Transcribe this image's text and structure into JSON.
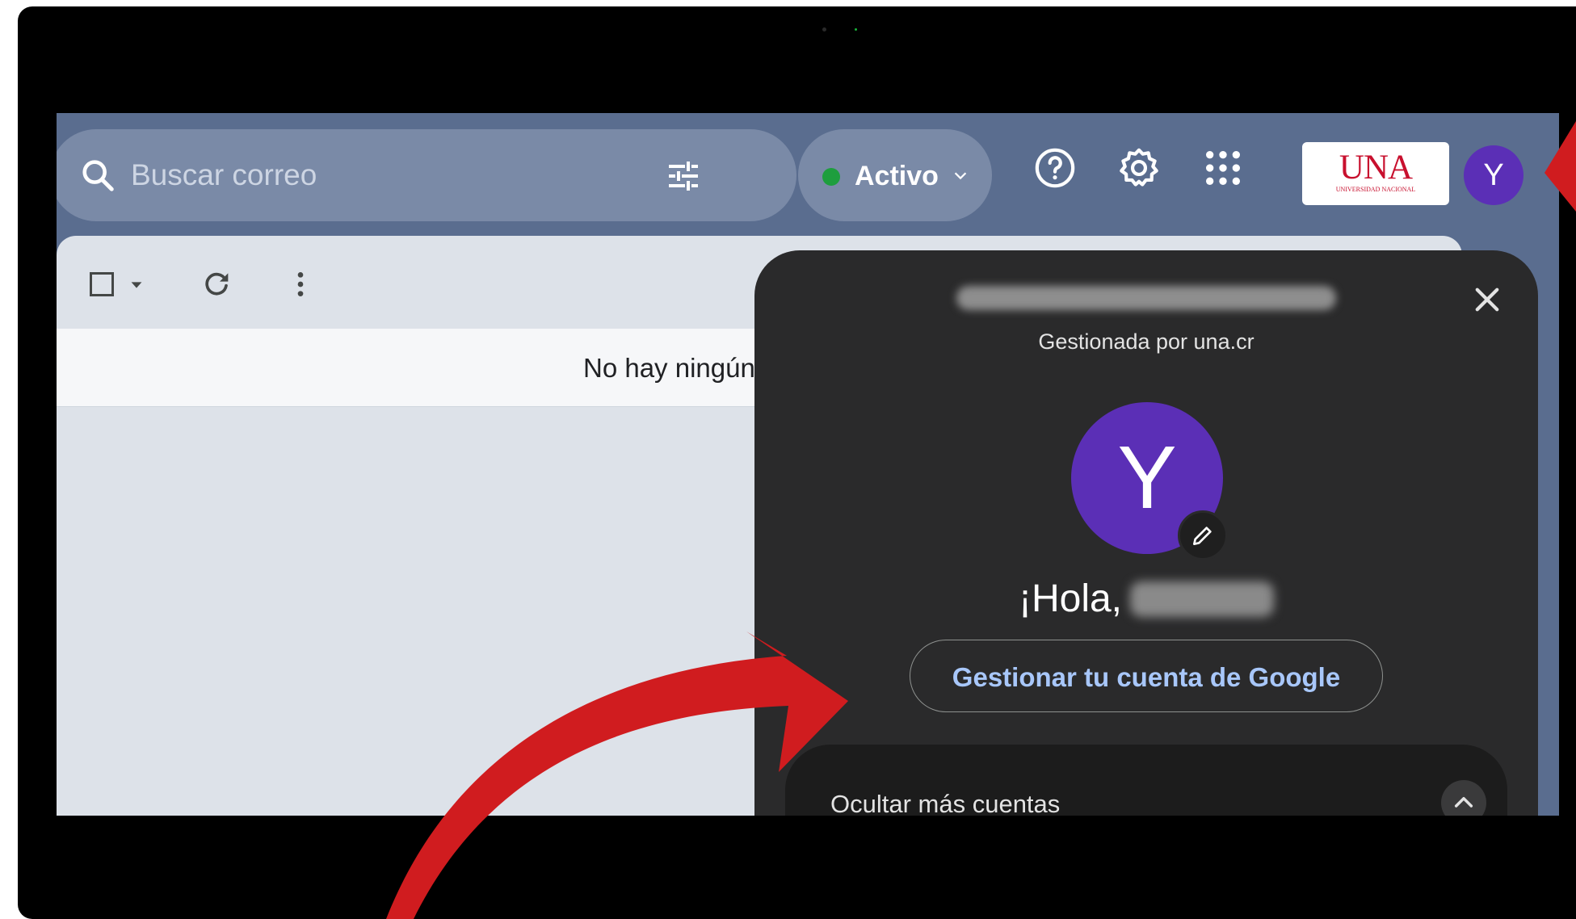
{
  "search": {
    "placeholder": "Buscar correo"
  },
  "status": {
    "label": "Activo",
    "dot_color": "#1e9e3e"
  },
  "header": {
    "icons": [
      "help-icon",
      "settings-icon",
      "apps-grid-icon"
    ],
    "logo": {
      "text": "UNA",
      "subtext": "UNIVERSIDAD NACIONAL"
    },
    "avatar_letter": "Y"
  },
  "mail": {
    "empty_message": "No hay ningún"
  },
  "account_popup": {
    "managed_by": "Gestionada por una.cr",
    "avatar_letter": "Y",
    "greeting": "¡Hola,",
    "manage_button": "Gestionar tu cuenta de Google",
    "hide_accounts": "Ocultar más cuentas"
  },
  "colors": {
    "accent_arrow": "#d01c1f",
    "avatar": "#5b2fb6",
    "link_text": "#a8c7fa"
  }
}
